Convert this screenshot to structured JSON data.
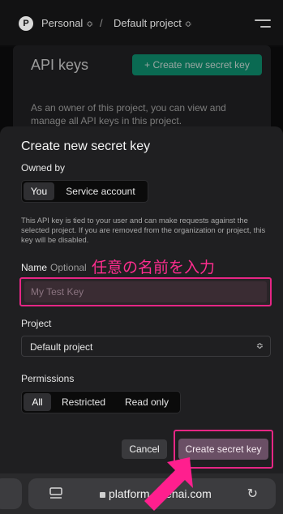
{
  "nav": {
    "org_initial": "P",
    "org_name": "Personal",
    "separator": "/",
    "project_name": "Default project",
    "chevron": "≎"
  },
  "background_page": {
    "title": "API keys",
    "create_button": "+ Create new secret key",
    "description": "As an owner of this project, you can view and manage all API keys in this project."
  },
  "modal": {
    "title": "Create new secret key",
    "owned_by_label": "Owned by",
    "owner_options": [
      "You",
      "Service account"
    ],
    "owner_selected": "You",
    "info_text": "This API key is tied to your user and can make requests against the selected project. If you are removed from the organization or project, this key will be disabled.",
    "name_label": "Name",
    "name_optional": "Optional",
    "name_placeholder": "My Test Key",
    "name_annotation": "任意の名前を入力",
    "project_label": "Project",
    "project_value": "Default project",
    "permissions_label": "Permissions",
    "permission_options": [
      "All",
      "Restricted",
      "Read only"
    ],
    "permission_selected": "All",
    "cancel_label": "Cancel",
    "create_label": "Create secret key"
  },
  "browser": {
    "url": "platform.openai.com"
  },
  "colors": {
    "accent_green": "#10a37f",
    "annotation_pink": "#e62685"
  }
}
